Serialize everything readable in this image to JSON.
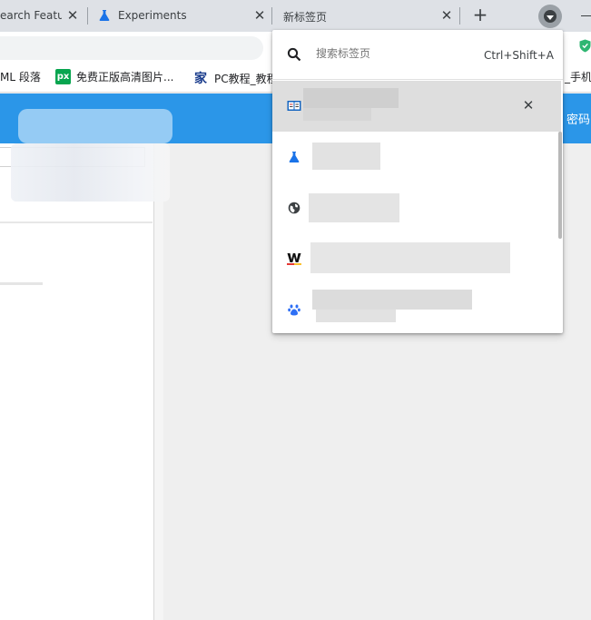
{
  "tabstrip": {
    "tabs": [
      {
        "title": "earch Featu",
        "close_label": "✕"
      },
      {
        "title": "Experiments",
        "close_label": "✕",
        "favicon": "flask-icon"
      },
      {
        "title": "新标签页",
        "close_label": "✕"
      }
    ],
    "new_tab_label": "+"
  },
  "bookmarks": {
    "items": [
      {
        "label": "ML 段落"
      },
      {
        "label": "免费正版高清图片...",
        "icon_text": "px"
      },
      {
        "label": "PC教程_教程",
        "icon_text": "家"
      },
      {
        "label": "_手机"
      }
    ]
  },
  "page": {
    "header_text": "密码"
  },
  "tab_search": {
    "placeholder": "搜索标签页",
    "shortcut": "Ctrl+Shift+A",
    "results": [
      {
        "icon": "book-icon",
        "selected": true,
        "close_label": "✕"
      },
      {
        "icon": "flask-icon",
        "selected": false
      },
      {
        "icon": "globe-icon",
        "selected": false
      },
      {
        "icon": "w-logo-icon",
        "selected": false
      },
      {
        "icon": "paw-icon",
        "selected": false
      }
    ]
  },
  "colors": {
    "header_blue": "#2b96e8",
    "tabstrip": "#dee1e6",
    "selected_row": "#dedede",
    "flask_blue": "#1a73e8"
  }
}
